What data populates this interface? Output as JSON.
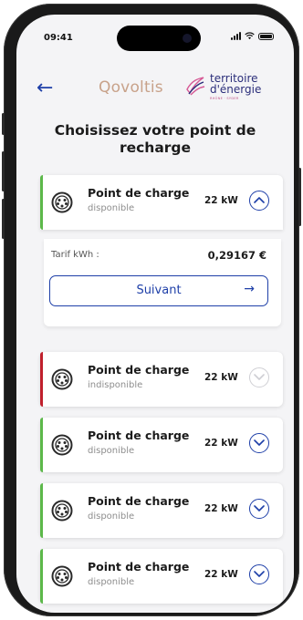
{
  "status_bar": {
    "time": "09:41"
  },
  "header": {
    "brand_left": "Qovoltis",
    "brand_right_line1": "territoire",
    "brand_right_line2": "d'énergie",
    "brand_right_sub": "RHÔNE · SYDER"
  },
  "page": {
    "title": "Choisissez votre point de recharge"
  },
  "selected": {
    "tarif_label": "Tarif kWh :",
    "tarif_value": "0,29167 €",
    "next_label": "Suivant",
    "next_arrow": "→"
  },
  "colors": {
    "accent": "#1e3fa8",
    "available": "#5cb84a",
    "unavailable": "#c0202c"
  },
  "cards": [
    {
      "name": "Point de charge",
      "status": "disponible",
      "power": "22 kW",
      "icon": "chevron-up-icon",
      "state": "available"
    },
    {
      "name": "Point de charge",
      "status": "indisponible",
      "power": "22 kW",
      "icon": "chevron-down-icon",
      "state": "unavailable"
    },
    {
      "name": "Point de charge",
      "status": "disponible",
      "power": "22 kW",
      "icon": "chevron-down-icon",
      "state": "available"
    },
    {
      "name": "Point de charge",
      "status": "disponible",
      "power": "22 kW",
      "icon": "chevron-down-icon",
      "state": "available"
    },
    {
      "name": "Point de charge",
      "status": "disponible",
      "power": "22 kW",
      "icon": "chevron-down-icon",
      "state": "available"
    }
  ]
}
